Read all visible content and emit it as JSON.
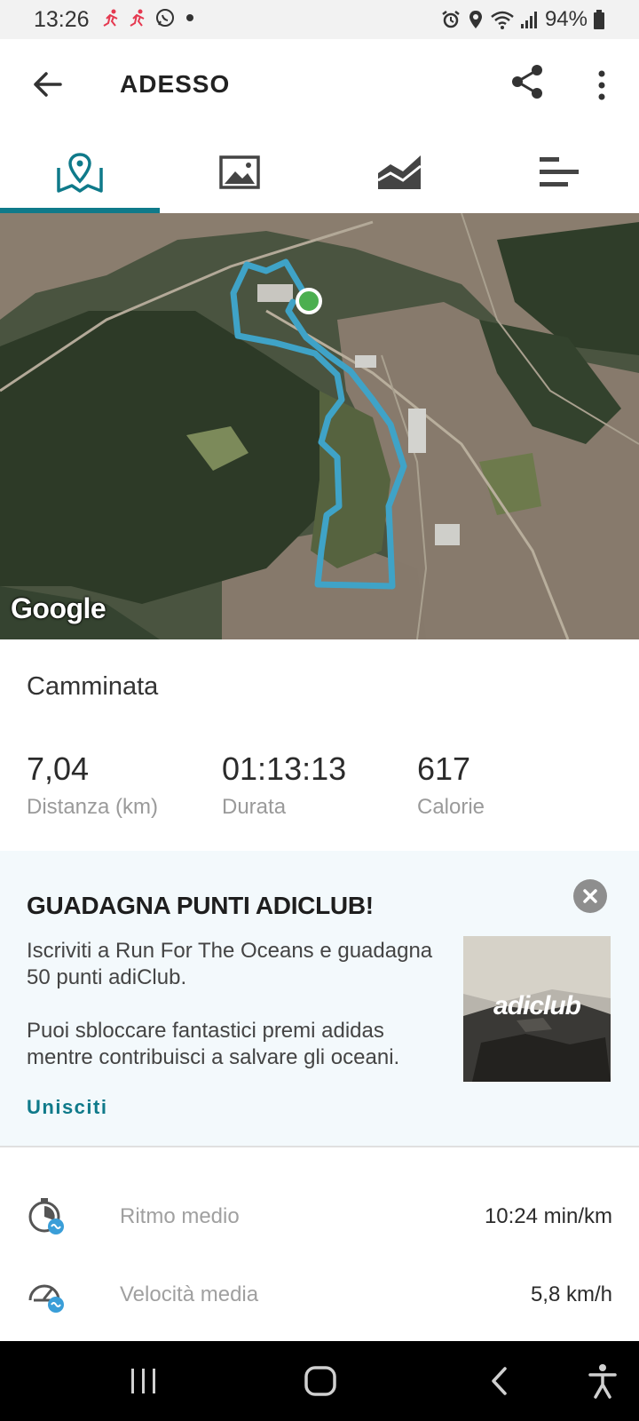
{
  "status_bar": {
    "time": "13:26",
    "battery": "94%",
    "icons": [
      "running-figure-icon",
      "running-figure-icon",
      "whatsapp-icon",
      "dot-icon",
      "alarm-icon",
      "location-icon",
      "wifi-icon",
      "signal-icon",
      "battery-icon"
    ]
  },
  "app_bar": {
    "title": "ADESSO",
    "icons": [
      "back-arrow-icon",
      "share-icon",
      "more-vert-icon"
    ]
  },
  "tabs": [
    {
      "icon": "map-pin-icon",
      "active": true
    },
    {
      "icon": "image-icon",
      "active": false
    },
    {
      "icon": "area-chart-icon",
      "active": false
    },
    {
      "icon": "bars-icon",
      "active": false
    }
  ],
  "map": {
    "attribution": "Google",
    "route_color": "#3fa3c7",
    "start_marker_color": "#4caf50"
  },
  "activity": {
    "type": "Camminata",
    "stats": [
      {
        "value": "7,04",
        "label": "Distanza (km)"
      },
      {
        "value": "01:13:13",
        "label": "Durata"
      },
      {
        "value": "617",
        "label": "Calorie"
      }
    ]
  },
  "promo": {
    "title": "GUADAGNA PUNTI ADICLUB!",
    "text1": "Iscriviti a Run For The Oceans e guadagna 50 punti adiClub.",
    "text2": "Puoi sbloccare fantastici premi adidas mentre contribuisci a salvare gli oceani.",
    "cta": "Unisciti",
    "image_logo": "adiclub",
    "close_icon": "close-icon"
  },
  "metrics": [
    {
      "icon": "pace-timer-icon",
      "label": "Ritmo medio",
      "value": "10:24 min/km"
    },
    {
      "icon": "speedometer-icon",
      "label": "Velocità media",
      "value": "5,8 km/h"
    }
  ],
  "nav_bar": {
    "icons": [
      "recents-icon",
      "home-icon",
      "back-icon",
      "accessibility-icon"
    ]
  },
  "colors": {
    "accent": "#0f7a8a",
    "promo_bg": "#f3f9fc",
    "muted_text": "#9a9a9a"
  }
}
